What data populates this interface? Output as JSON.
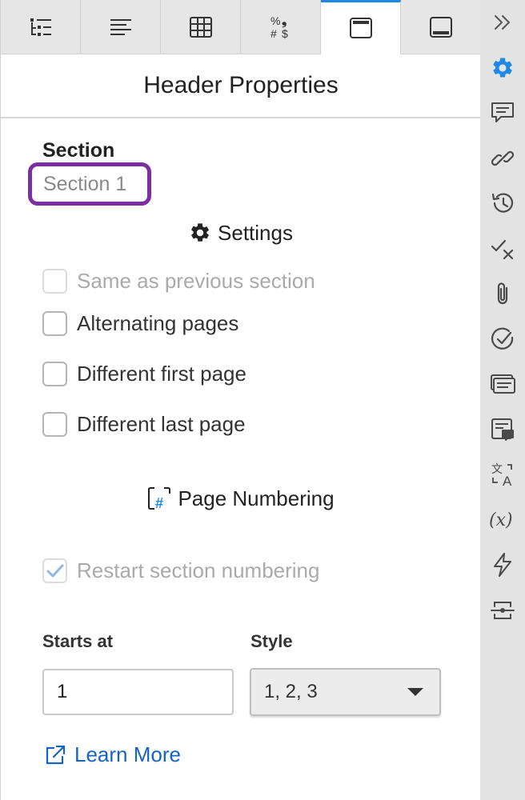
{
  "panel": {
    "title": "Header Properties",
    "tabs": [
      {
        "icon": "outline-list-icon",
        "active": false
      },
      {
        "icon": "paragraph-align-icon",
        "active": false
      },
      {
        "icon": "table-grid-icon",
        "active": false
      },
      {
        "icon": "number-format-icon",
        "active": false,
        "glyphs": [
          "%",
          "❟",
          "#",
          "$"
        ]
      },
      {
        "icon": "header-icon",
        "active": true
      },
      {
        "icon": "footer-icon",
        "active": false
      }
    ]
  },
  "section": {
    "label": "Section",
    "value": "Section 1"
  },
  "settings": {
    "heading": "Settings",
    "options": [
      {
        "label": "Same as previous section",
        "checked": false,
        "disabled": true
      },
      {
        "label": "Alternating pages",
        "checked": false,
        "disabled": false
      },
      {
        "label": "Different first page",
        "checked": false,
        "disabled": false
      },
      {
        "label": "Different last page",
        "checked": false,
        "disabled": false
      }
    ]
  },
  "page_numbering": {
    "heading": "Page Numbering",
    "restart": {
      "label": "Restart section numbering",
      "checked": true,
      "disabled": true
    },
    "starts_at": {
      "label": "Starts at",
      "value": "1"
    },
    "style": {
      "label": "Style",
      "value": "1, 2, 3"
    }
  },
  "learn_more": "Learn More",
  "sidebar": {
    "icons": [
      "collapse-icon",
      "gear-icon",
      "comment-icon",
      "link-icon",
      "history-icon",
      "accept-reject-icon",
      "attachment-icon",
      "check-circle-icon",
      "fields-icon",
      "review-icon",
      "translate-icon",
      "variable-icon",
      "lightning-icon",
      "split-icon"
    ],
    "variable_glyph": "(x)"
  },
  "colors": {
    "accent": "#1e88e5",
    "highlight": "#7b2fa0",
    "link": "#1565c0"
  }
}
